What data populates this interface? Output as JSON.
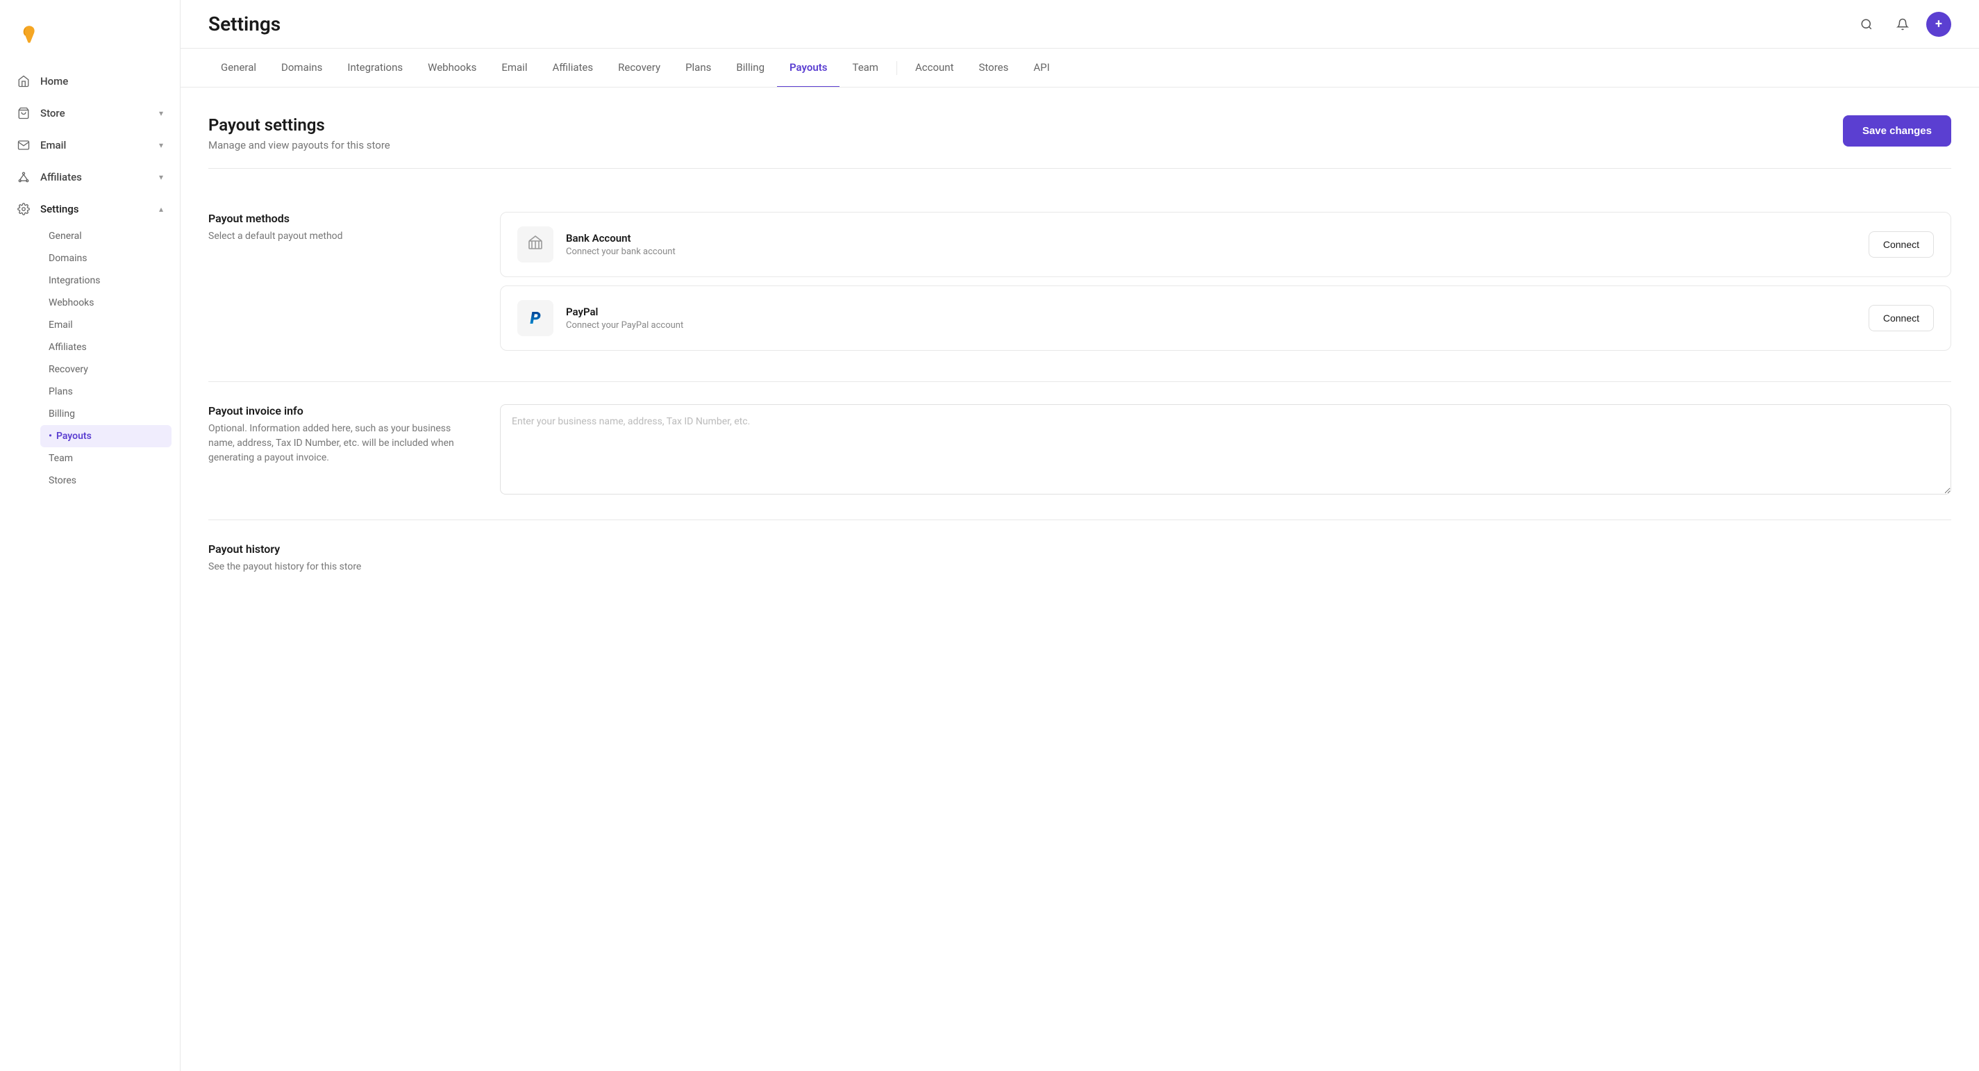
{
  "app": {
    "logo_alt": "App Logo"
  },
  "sidebar": {
    "items": [
      {
        "id": "home",
        "label": "Home",
        "icon": "home"
      },
      {
        "id": "store",
        "label": "Store",
        "icon": "store",
        "has_chevron": true
      },
      {
        "id": "email",
        "label": "Email",
        "icon": "email",
        "has_chevron": true
      },
      {
        "id": "affiliates",
        "label": "Affiliates",
        "icon": "affiliates",
        "has_chevron": true
      },
      {
        "id": "settings",
        "label": "Settings",
        "icon": "settings",
        "has_chevron": true,
        "active": true
      }
    ],
    "subnav": [
      {
        "id": "general",
        "label": "General"
      },
      {
        "id": "domains",
        "label": "Domains"
      },
      {
        "id": "integrations",
        "label": "Integrations"
      },
      {
        "id": "webhooks",
        "label": "Webhooks"
      },
      {
        "id": "email",
        "label": "Email"
      },
      {
        "id": "affiliates",
        "label": "Affiliates"
      },
      {
        "id": "recovery",
        "label": "Recovery"
      },
      {
        "id": "plans",
        "label": "Plans"
      },
      {
        "id": "billing",
        "label": "Billing"
      },
      {
        "id": "payouts",
        "label": "Payouts",
        "active": true
      },
      {
        "id": "team",
        "label": "Team"
      },
      {
        "id": "stores",
        "label": "Stores"
      }
    ]
  },
  "header": {
    "title": "Settings",
    "search_label": "Search",
    "notifications_label": "Notifications",
    "add_label": "Add"
  },
  "tabs": [
    {
      "id": "general",
      "label": "General"
    },
    {
      "id": "domains",
      "label": "Domains"
    },
    {
      "id": "integrations",
      "label": "Integrations"
    },
    {
      "id": "webhooks",
      "label": "Webhooks"
    },
    {
      "id": "email",
      "label": "Email"
    },
    {
      "id": "affiliates",
      "label": "Affiliates"
    },
    {
      "id": "recovery",
      "label": "Recovery"
    },
    {
      "id": "plans",
      "label": "Plans"
    },
    {
      "id": "billing",
      "label": "Billing"
    },
    {
      "id": "payouts",
      "label": "Payouts",
      "active": true
    },
    {
      "id": "team",
      "label": "Team"
    },
    {
      "id": "sep1",
      "separator": true
    },
    {
      "id": "account",
      "label": "Account"
    },
    {
      "id": "stores",
      "label": "Stores"
    },
    {
      "id": "api",
      "label": "API"
    }
  ],
  "page": {
    "title": "Payout settings",
    "subtitle": "Manage and view payouts for this store",
    "save_button": "Save changes"
  },
  "payout_methods": {
    "section_title": "Payout methods",
    "section_subtitle": "Select a default payout method",
    "methods": [
      {
        "id": "bank",
        "name": "Bank Account",
        "description": "Connect your bank account",
        "connect_label": "Connect"
      },
      {
        "id": "paypal",
        "name": "PayPal",
        "description": "Connect your PayPal account",
        "connect_label": "Connect"
      }
    ]
  },
  "payout_invoice": {
    "section_title": "Payout invoice info",
    "section_subtitle": "Optional. Information added here, such as your business name, address, Tax ID Number, etc. will be included when generating a payout invoice.",
    "placeholder": "Enter your business name, address, Tax ID Number, etc."
  },
  "payout_history": {
    "section_title": "Payout history",
    "section_subtitle": "See the payout history for this store"
  }
}
